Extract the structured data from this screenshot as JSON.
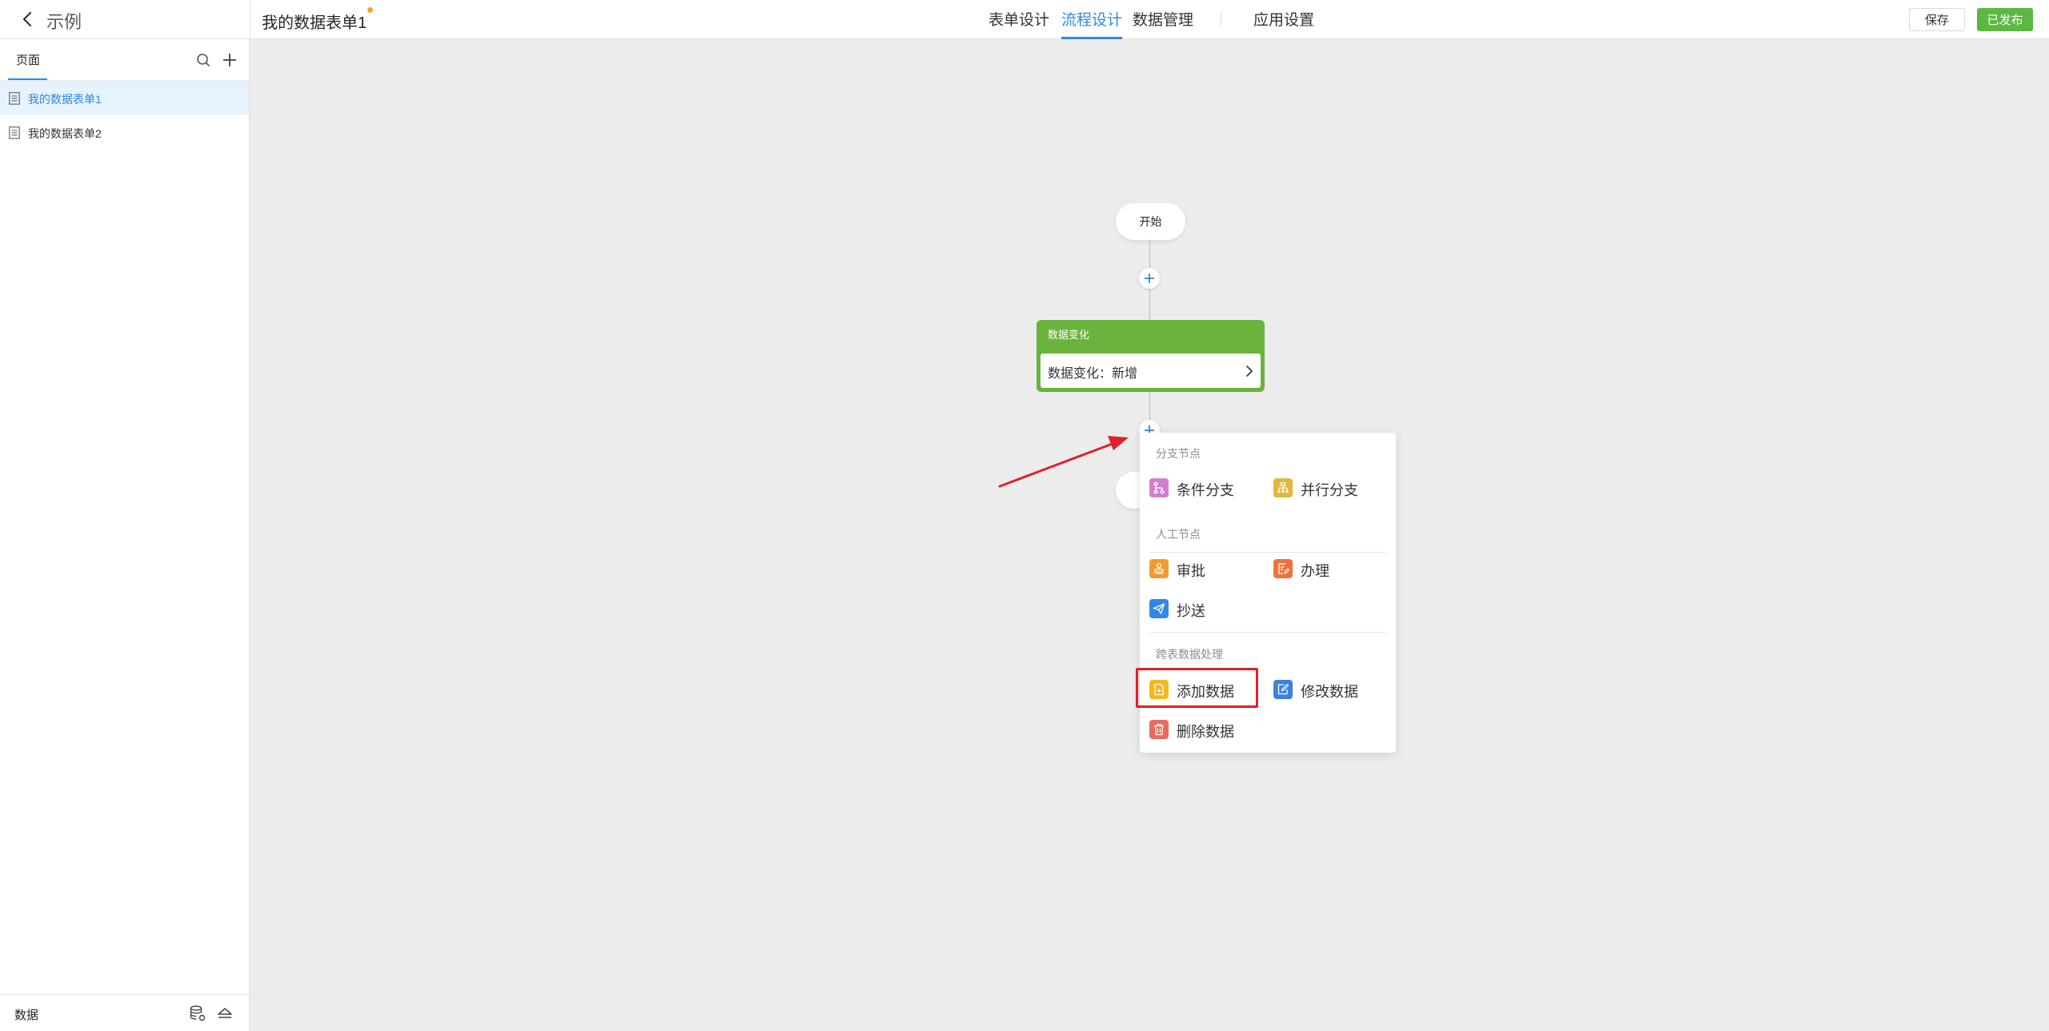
{
  "header": {
    "app_name": "示例",
    "form_title": "我的数据表单1",
    "tabs": [
      {
        "label": "表单设计"
      },
      {
        "label": "流程设计",
        "active": true
      },
      {
        "label": "数据管理"
      },
      {
        "label": "应用设置"
      }
    ],
    "save_label": "保存",
    "publish_label": "已发布"
  },
  "sidebar": {
    "tab_label": "页面",
    "pages": [
      {
        "label": "我的数据表单1",
        "selected": true
      },
      {
        "label": "我的数据表单2"
      }
    ],
    "footer_label": "数据"
  },
  "flow": {
    "start_label": "开始",
    "trigger": {
      "title": "数据变化",
      "body": "数据变化：新增"
    }
  },
  "menu": {
    "sections": [
      {
        "title": "分支节点",
        "items": [
          {
            "label": "条件分支",
            "icon": "condition-branch-icon",
            "color": "#d47ed0"
          },
          {
            "label": "并行分支",
            "icon": "parallel-branch-icon",
            "color": "#e2b73c"
          }
        ]
      },
      {
        "title": "人工节点",
        "items": [
          {
            "label": "审批",
            "icon": "approval-stamp-icon",
            "color": "#f39a2c"
          },
          {
            "label": "办理",
            "icon": "handle-task-icon",
            "color": "#f0723a"
          },
          {
            "label": "抄送",
            "icon": "send-copy-icon",
            "color": "#2f88e6"
          }
        ]
      },
      {
        "title": "跨表数据处理",
        "items": [
          {
            "label": "添加数据",
            "icon": "add-data-icon",
            "color": "#f2b81c"
          },
          {
            "label": "修改数据",
            "icon": "edit-data-icon",
            "color": "#3a82e0"
          },
          {
            "label": "删除数据",
            "icon": "delete-data-icon",
            "color": "#ec6a5f"
          }
        ]
      }
    ]
  },
  "colors": {
    "accent": "#2f88e6",
    "publish": "#5cb842",
    "trigger": "#6ab33c",
    "highlight": "#e0202a"
  }
}
